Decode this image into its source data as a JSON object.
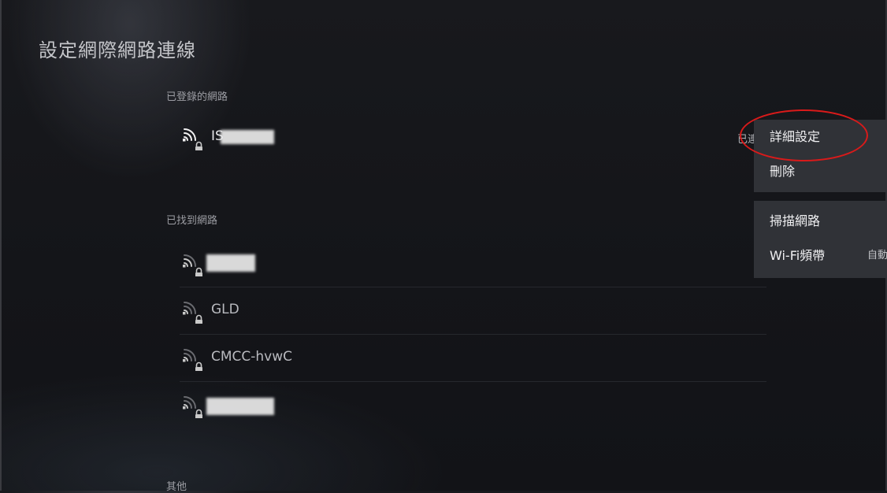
{
  "page": {
    "title": "設定網際網路連線"
  },
  "sections": {
    "registered": "已登錄的網路",
    "found": "已找到網路",
    "other": "其他"
  },
  "registered_networks": [
    {
      "name": "IS",
      "status": "已連"
    }
  ],
  "found_networks": [
    {
      "name": ""
    },
    {
      "name": "GLD"
    },
    {
      "name": "CMCC-hvwC"
    },
    {
      "name": ""
    }
  ],
  "context_menu": {
    "group1": {
      "details": "詳細設定",
      "delete": "刪除"
    },
    "group2": {
      "scan": "掃描網路",
      "wifi_band": "Wi-Fi頻帶",
      "wifi_band_value": "自動"
    }
  },
  "icons": {
    "network": "wifi-signal-icon",
    "lock": "lock-icon"
  },
  "colors": {
    "background": "#16171b",
    "menu": "#303237",
    "annotation": "#d91a1a"
  }
}
